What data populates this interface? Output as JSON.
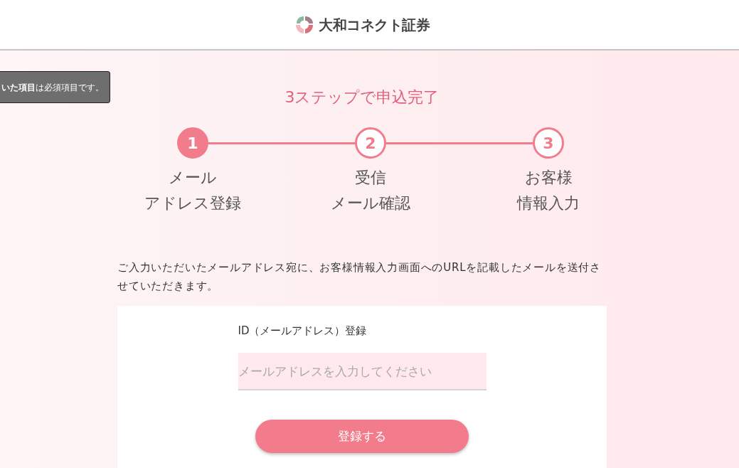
{
  "header": {
    "logo_text": "大和コネクト証券"
  },
  "required_note": "**いた項目**は必須項目です。",
  "steps_title": "3ステップで申込完了",
  "steps": [
    {
      "number": "1",
      "label_lines": [
        "メール",
        "アドレス登録"
      ],
      "active": true
    },
    {
      "number": "2",
      "label_lines": [
        "受信",
        "メール確認"
      ],
      "active": false
    },
    {
      "number": "3",
      "label_lines": [
        "お客様",
        "情報入力"
      ],
      "active": false
    }
  ],
  "intro": "ご入力いただいたメールアドレス宛に、お客様情報入力画面へのURLを記載したメールを送付させていただきます。",
  "form": {
    "label": "ID（メールアドレス）登録",
    "email_field": {
      "placeholder": "メールアドレスを入力してください"
    },
    "submit_button": "登録する"
  }
}
